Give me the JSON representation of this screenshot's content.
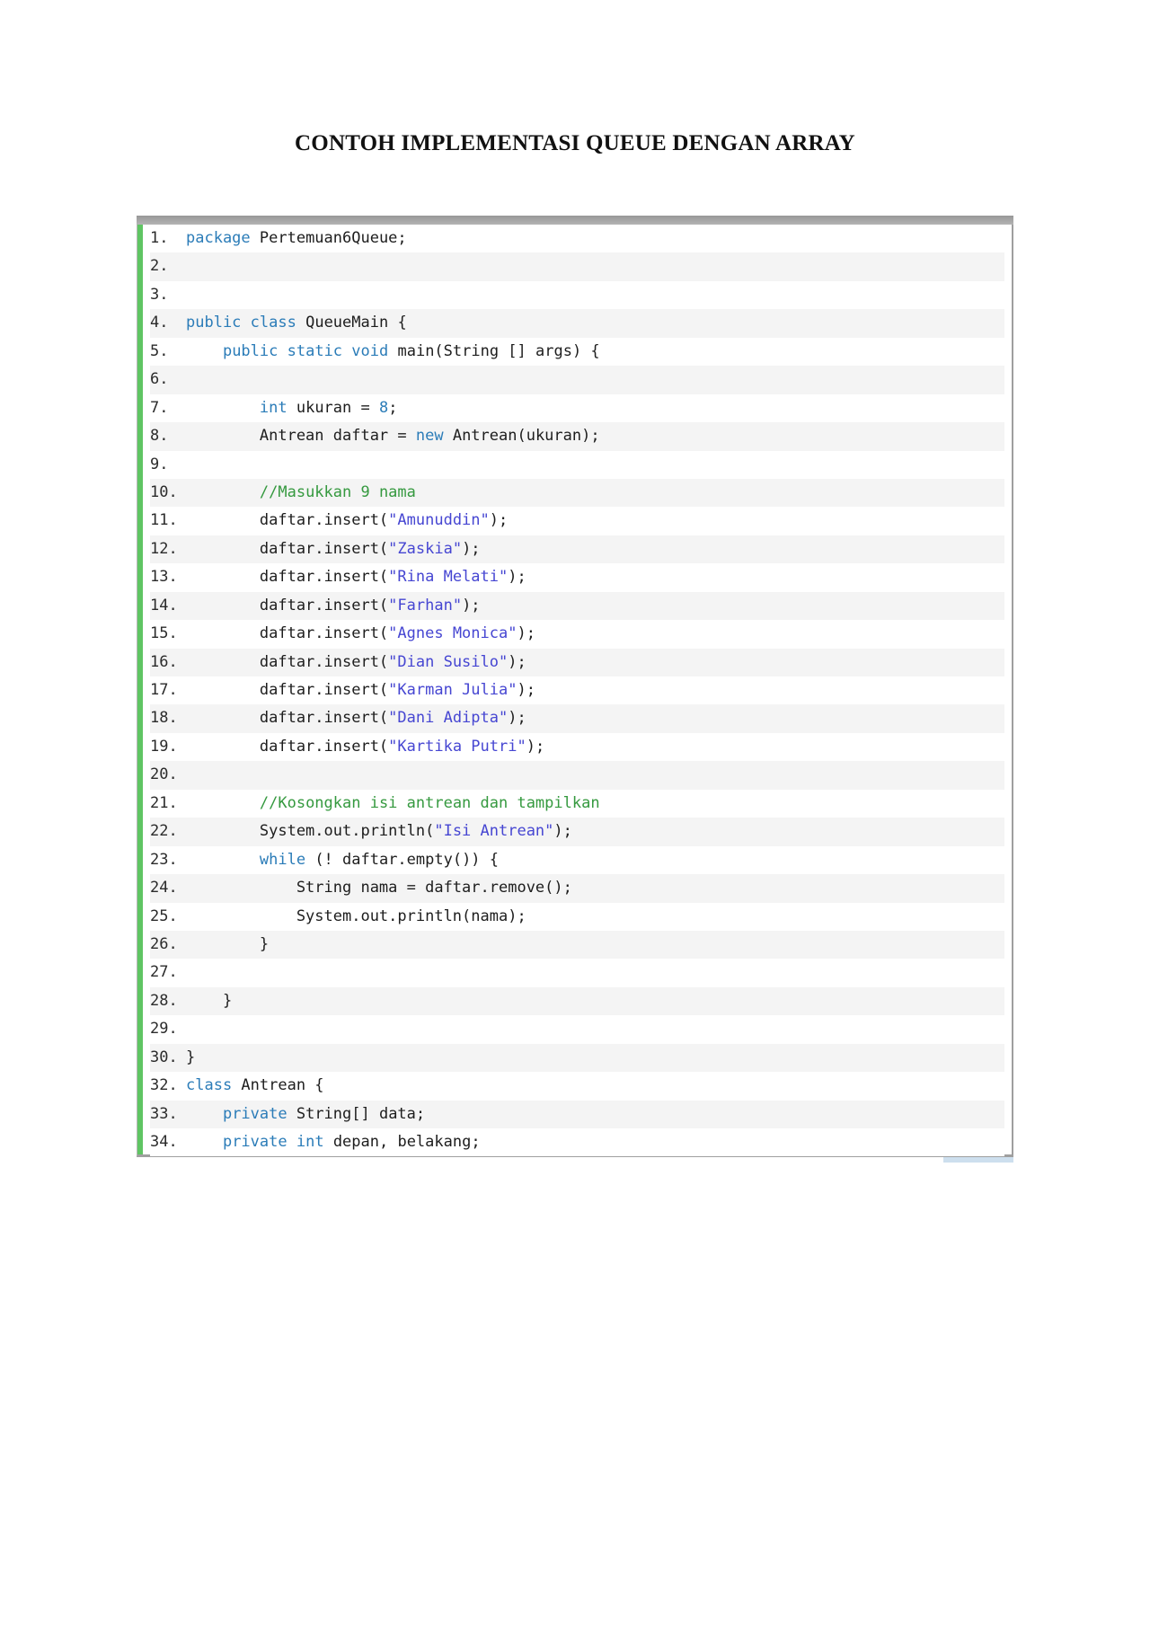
{
  "page_title": "CONTOH IMPLEMENTASI QUEUE DENGAN ARRAY",
  "colors": {
    "keyword": "#2b7cb8",
    "string": "#4646d2",
    "comment": "#35993f",
    "number": "#2b7cb8",
    "plain": "#1d1d1d",
    "line_number": "#2b2b2b",
    "accent_green": "#5fc563",
    "stripe": "#f4f4f4",
    "frame_gray": "#a5a5a5",
    "scrollbar_fragment": "#cddfee"
  },
  "code": {
    "language": "java",
    "lines": [
      {
        "n": "1.",
        "tokens": [
          [
            "kw",
            "package"
          ],
          [
            "pl",
            " Pertemuan6Queue;"
          ]
        ]
      },
      {
        "n": "2.",
        "tokens": []
      },
      {
        "n": "3.",
        "tokens": []
      },
      {
        "n": "4.",
        "tokens": [
          [
            "kw",
            "public"
          ],
          [
            "pl",
            " "
          ],
          [
            "kw",
            "class"
          ],
          [
            "pl",
            " QueueMain {"
          ]
        ]
      },
      {
        "n": "5.",
        "tokens": [
          [
            "pl",
            "    "
          ],
          [
            "kw",
            "public"
          ],
          [
            "pl",
            " "
          ],
          [
            "kw",
            "static"
          ],
          [
            "pl",
            " "
          ],
          [
            "kw",
            "void"
          ],
          [
            "pl",
            " main(String [] args) {"
          ]
        ]
      },
      {
        "n": "6.",
        "tokens": []
      },
      {
        "n": "7.",
        "tokens": [
          [
            "pl",
            "        "
          ],
          [
            "kw",
            "int"
          ],
          [
            "pl",
            " ukuran = "
          ],
          [
            "num",
            "8"
          ],
          [
            "pl",
            ";"
          ]
        ]
      },
      {
        "n": "8.",
        "tokens": [
          [
            "pl",
            "        Antrean daftar = "
          ],
          [
            "kw",
            "new"
          ],
          [
            "pl",
            " Antrean(ukuran);"
          ]
        ]
      },
      {
        "n": "9.",
        "tokens": []
      },
      {
        "n": "10.",
        "tokens": [
          [
            "pl",
            "        "
          ],
          [
            "com",
            "//Masukkan 9 nama"
          ]
        ]
      },
      {
        "n": "11.",
        "tokens": [
          [
            "pl",
            "        daftar.insert("
          ],
          [
            "str",
            "\"Amunuddin\""
          ],
          [
            "pl",
            ");"
          ]
        ]
      },
      {
        "n": "12.",
        "tokens": [
          [
            "pl",
            "        daftar.insert("
          ],
          [
            "str",
            "\"Zaskia\""
          ],
          [
            "pl",
            ");"
          ]
        ]
      },
      {
        "n": "13.",
        "tokens": [
          [
            "pl",
            "        daftar.insert("
          ],
          [
            "str",
            "\"Rina Melati\""
          ],
          [
            "pl",
            ");"
          ]
        ]
      },
      {
        "n": "14.",
        "tokens": [
          [
            "pl",
            "        daftar.insert("
          ],
          [
            "str",
            "\"Farhan\""
          ],
          [
            "pl",
            ");"
          ]
        ]
      },
      {
        "n": "15.",
        "tokens": [
          [
            "pl",
            "        daftar.insert("
          ],
          [
            "str",
            "\"Agnes Monica\""
          ],
          [
            "pl",
            ");"
          ]
        ]
      },
      {
        "n": "16.",
        "tokens": [
          [
            "pl",
            "        daftar.insert("
          ],
          [
            "str",
            "\"Dian Susilo\""
          ],
          [
            "pl",
            ");"
          ]
        ]
      },
      {
        "n": "17.",
        "tokens": [
          [
            "pl",
            "        daftar.insert("
          ],
          [
            "str",
            "\"Karman Julia\""
          ],
          [
            "pl",
            ");"
          ]
        ]
      },
      {
        "n": "18.",
        "tokens": [
          [
            "pl",
            "        daftar.insert("
          ],
          [
            "str",
            "\"Dani Adipta\""
          ],
          [
            "pl",
            ");"
          ]
        ]
      },
      {
        "n": "19.",
        "tokens": [
          [
            "pl",
            "        daftar.insert("
          ],
          [
            "str",
            "\"Kartika Putri\""
          ],
          [
            "pl",
            ");"
          ]
        ]
      },
      {
        "n": "20.",
        "tokens": []
      },
      {
        "n": "21.",
        "tokens": [
          [
            "pl",
            "        "
          ],
          [
            "com",
            "//Kosongkan isi antrean dan tampilkan"
          ]
        ]
      },
      {
        "n": "22.",
        "tokens": [
          [
            "pl",
            "        System.out.println("
          ],
          [
            "str",
            "\"Isi Antrean\""
          ],
          [
            "pl",
            ");"
          ]
        ]
      },
      {
        "n": "23.",
        "tokens": [
          [
            "pl",
            "        "
          ],
          [
            "kw",
            "while"
          ],
          [
            "pl",
            " (! daftar.empty()) {"
          ]
        ]
      },
      {
        "n": "24.",
        "tokens": [
          [
            "pl",
            "            String nama = daftar.remove();"
          ]
        ]
      },
      {
        "n": "25.",
        "tokens": [
          [
            "pl",
            "            System.out.println(nama);"
          ]
        ]
      },
      {
        "n": "26.",
        "tokens": [
          [
            "pl",
            "        }"
          ]
        ]
      },
      {
        "n": "27.",
        "tokens": []
      },
      {
        "n": "28.",
        "tokens": [
          [
            "pl",
            "    }"
          ]
        ]
      },
      {
        "n": "29.",
        "tokens": []
      },
      {
        "n": "30.",
        "tokens": [
          [
            "pl",
            "}"
          ]
        ]
      },
      {
        "n": "32.",
        "tokens": [
          [
            "kw",
            "class"
          ],
          [
            "pl",
            " Antrean {"
          ]
        ]
      },
      {
        "n": "33.",
        "tokens": [
          [
            "pl",
            "    "
          ],
          [
            "kw",
            "private"
          ],
          [
            "pl",
            " String[] data;"
          ]
        ]
      },
      {
        "n": "34.",
        "tokens": [
          [
            "pl",
            "    "
          ],
          [
            "kw",
            "private"
          ],
          [
            "pl",
            " "
          ],
          [
            "kw",
            "int"
          ],
          [
            "pl",
            " depan, belakang;"
          ]
        ]
      }
    ]
  }
}
